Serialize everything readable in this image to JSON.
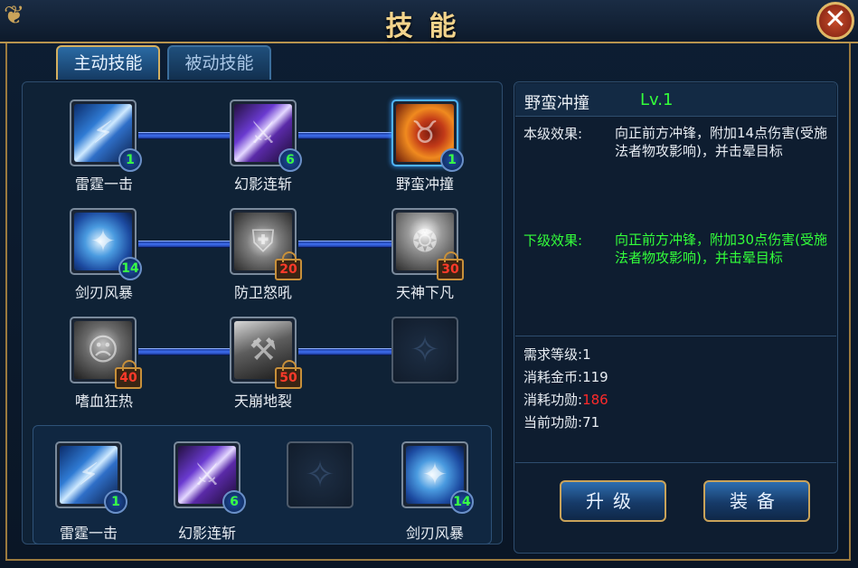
{
  "window": {
    "title": "技能",
    "close_symbol": "✕"
  },
  "tabs": [
    {
      "label": "主动技能",
      "active": true
    },
    {
      "label": "被动技能",
      "active": false
    }
  ],
  "skill_tree": {
    "rows": [
      [
        {
          "name": "雷霆一击",
          "level": "1",
          "icon": "lightning-slash-icon"
        },
        {
          "name": "幻影连斩",
          "level": "6",
          "icon": "phantom-slash-icon"
        },
        {
          "name": "野蛮冲撞",
          "level": "1",
          "icon": "savage-charge-icon",
          "selected": true
        }
      ],
      [
        {
          "name": "剑刃风暴",
          "level": "14",
          "icon": "blade-storm-icon"
        },
        {
          "name": "防卫怒吼",
          "required_level": "20",
          "icon": "shield-roar-icon"
        },
        {
          "name": "天神下凡",
          "required_level": "30",
          "icon": "angel-descent-icon"
        }
      ],
      [
        {
          "name": "嗜血狂热",
          "required_level": "40",
          "icon": "bloodlust-icon"
        },
        {
          "name": "天崩地裂",
          "required_level": "50",
          "icon": "earthquake-icon"
        },
        {
          "name": "",
          "icon": "empty-slot-icon"
        }
      ]
    ]
  },
  "skill_bar": [
    {
      "name": "雷霆一击",
      "level": "1",
      "icon": "lightning-slash-icon"
    },
    {
      "name": "幻影连斩",
      "level": "6",
      "icon": "phantom-slash-icon"
    },
    {
      "name": "",
      "icon": "empty-slot-icon"
    },
    {
      "name": "剑刃风暴",
      "level": "14",
      "icon": "blade-storm-icon"
    }
  ],
  "details": {
    "skill_name": "野蛮冲撞",
    "skill_level": "Lv.1",
    "current_label": "本级效果:",
    "current_text": "向正前方冲锋，附加14点伤害(受施法者物攻影响)，并击晕目标",
    "next_label": "下级效果:",
    "next_text": "向正前方冲锋，附加30点伤害(受施法者物攻影响)，并击晕目标",
    "req_level_label": "需求等级:",
    "req_level": "1",
    "gold_cost_label": "消耗金币:",
    "gold_cost": "119",
    "merit_cost_label": "消耗功勋:",
    "merit_cost": "186",
    "current_merit_label": "当前功勋:",
    "current_merit": "71"
  },
  "buttons": {
    "upgrade": "升级",
    "equip": "装备"
  },
  "colors": {
    "gold": "#f3d48c",
    "green": "#33ff3a",
    "red": "#ff2a2a",
    "panel": "#0f2236"
  }
}
